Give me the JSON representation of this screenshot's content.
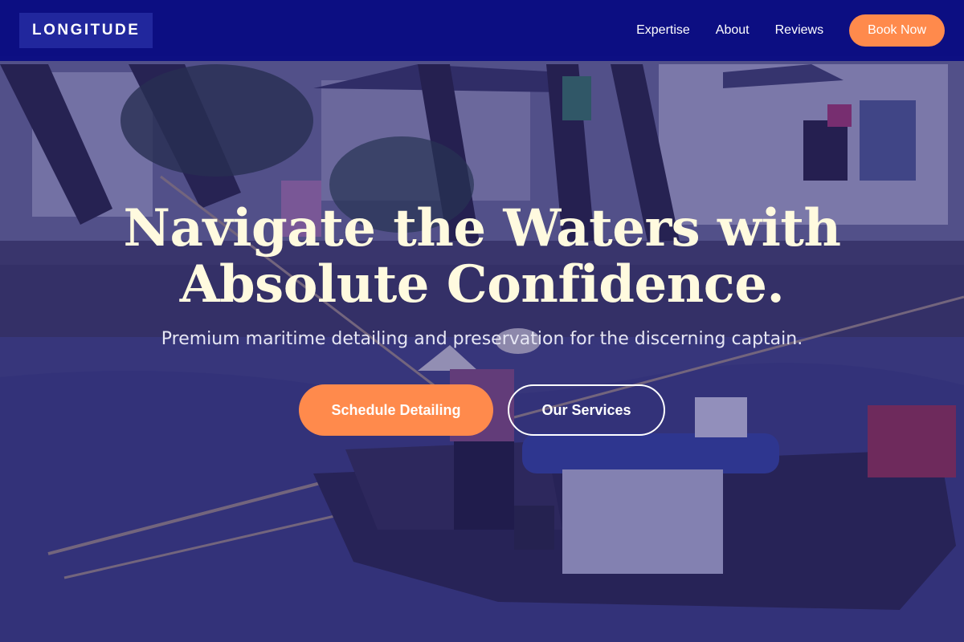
{
  "brand": {
    "logo_text": "LONGITUDE"
  },
  "nav": {
    "links": [
      "Expertise",
      "About",
      "Reviews"
    ],
    "cta_label": "Book Now"
  },
  "hero": {
    "title_line1": "Navigate the Waters with",
    "title_line2": "Absolute Confidence.",
    "subtitle": "Premium maritime detailing and preservation for the discerning captain.",
    "primary_button": "Schedule Detailing",
    "secondary_button": "Our Services",
    "background_image": "canal-boat-photo"
  },
  "colors": {
    "nav_background": "#080a82",
    "accent": "#ff8a4c",
    "title": "#fffadf",
    "overlay": "#1e1978"
  }
}
